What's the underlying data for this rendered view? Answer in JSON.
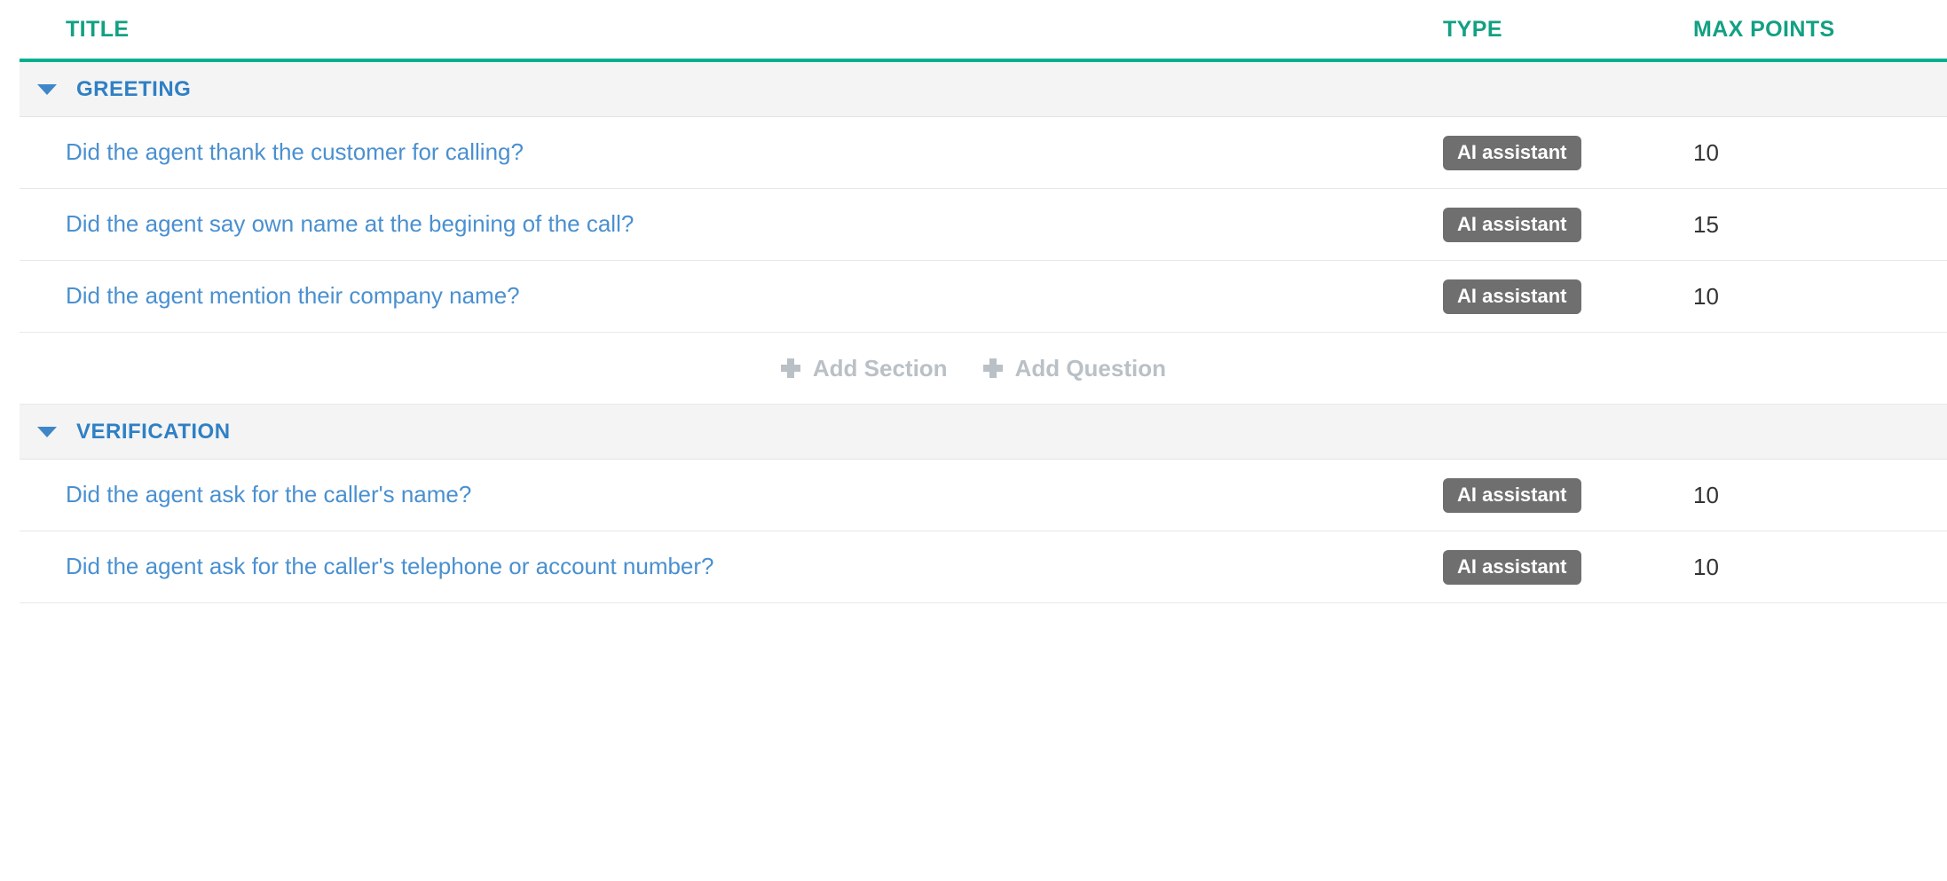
{
  "table": {
    "columns": {
      "title": "TITLE",
      "type": "TYPE",
      "max_points": "MAX POINTS"
    },
    "accent_color": "#00b08c",
    "header_text_color": "#12a083",
    "link_color": "#4a90d0",
    "section_label_color": "#2f80c4",
    "badge_color": "#6f6f6f",
    "section_row_bg": "#f4f4f4",
    "sections": [
      {
        "name": "GREETING",
        "caret": "caret-down-icon",
        "expanded": true,
        "questions": [
          {
            "title": "Did the agent thank the customer for calling?",
            "type": "AI assistant",
            "max_points": "10"
          },
          {
            "title": "Did the agent say own name at the begining of the call?",
            "type": "AI assistant",
            "max_points": "15"
          },
          {
            "title": "Did the agent mention their company name?",
            "type": "AI assistant",
            "max_points": "10"
          }
        ],
        "actions": [
          {
            "icon": "plus-icon",
            "label": "Add Section"
          },
          {
            "icon": "plus-icon",
            "label": "Add Question"
          }
        ]
      },
      {
        "name": "VERIFICATION",
        "caret": "caret-down-icon",
        "expanded": true,
        "questions": [
          {
            "title": "Did the agent ask for the caller's name?",
            "type": "AI assistant",
            "max_points": "10"
          },
          {
            "title": "Did the agent ask for the caller's telephone or account number?",
            "type": "AI assistant",
            "max_points": "10"
          }
        ],
        "actions": []
      }
    ]
  }
}
